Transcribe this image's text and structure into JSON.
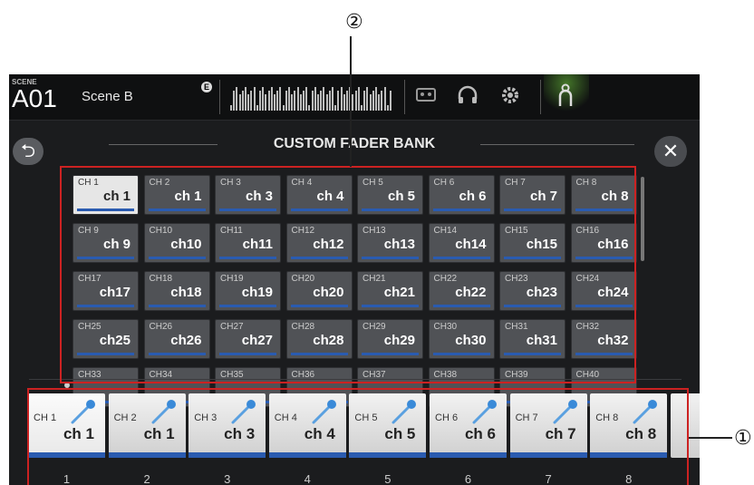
{
  "callouts": {
    "top": "②",
    "right": "①"
  },
  "topbar": {
    "scene_label": "SCENE",
    "scene_number": "A01",
    "scene_name": "Scene B",
    "edit_badge": "E"
  },
  "icons": {
    "recorder": "recorder-icon",
    "headphones": "headphones-icon",
    "settings": "gear-icon",
    "user": "user-icon",
    "back": "back-arrow-icon",
    "close": "close-icon",
    "mic": "microphone-icon"
  },
  "dialog": {
    "title": "CUSTOM FADER BANK",
    "back_symbol": "⮌",
    "close_symbol": "✕"
  },
  "accent_color": "#2a5bb0",
  "channel_grid": [
    {
      "num": "CH 1",
      "name": "ch 1",
      "selected": true
    },
    {
      "num": "CH 2",
      "name": "ch 1"
    },
    {
      "num": "CH 3",
      "name": "ch 3"
    },
    {
      "num": "CH 4",
      "name": "ch 4"
    },
    {
      "num": "CH 5",
      "name": "ch 5"
    },
    {
      "num": "CH 6",
      "name": "ch 6"
    },
    {
      "num": "CH 7",
      "name": "ch 7"
    },
    {
      "num": "CH 8",
      "name": "ch 8"
    },
    {
      "num": "CH 9",
      "name": "ch 9"
    },
    {
      "num": "CH10",
      "name": "ch10"
    },
    {
      "num": "CH11",
      "name": "ch11"
    },
    {
      "num": "CH12",
      "name": "ch12"
    },
    {
      "num": "CH13",
      "name": "ch13"
    },
    {
      "num": "CH14",
      "name": "ch14"
    },
    {
      "num": "CH15",
      "name": "ch15"
    },
    {
      "num": "CH16",
      "name": "ch16"
    },
    {
      "num": "CH17",
      "name": "ch17"
    },
    {
      "num": "CH18",
      "name": "ch18"
    },
    {
      "num": "CH19",
      "name": "ch19"
    },
    {
      "num": "CH20",
      "name": "ch20"
    },
    {
      "num": "CH21",
      "name": "ch21"
    },
    {
      "num": "CH22",
      "name": "ch22"
    },
    {
      "num": "CH23",
      "name": "ch23"
    },
    {
      "num": "CH24",
      "name": "ch24"
    },
    {
      "num": "CH25",
      "name": "ch25"
    },
    {
      "num": "CH26",
      "name": "ch26"
    },
    {
      "num": "CH27",
      "name": "ch27"
    },
    {
      "num": "CH28",
      "name": "ch28"
    },
    {
      "num": "CH29",
      "name": "ch29"
    },
    {
      "num": "CH30",
      "name": "ch30"
    },
    {
      "num": "CH31",
      "name": "ch31"
    },
    {
      "num": "CH32",
      "name": "ch32"
    },
    {
      "num": "CH33",
      "name": ""
    },
    {
      "num": "CH34",
      "name": ""
    },
    {
      "num": "CH35",
      "name": ""
    },
    {
      "num": "CH36",
      "name": ""
    },
    {
      "num": "CH37",
      "name": ""
    },
    {
      "num": "CH38",
      "name": ""
    },
    {
      "num": "CH39",
      "name": ""
    },
    {
      "num": "CH40",
      "name": ""
    }
  ],
  "fader_bank": [
    {
      "num": "CH 1",
      "name": "ch 1",
      "index": "1",
      "selected": true
    },
    {
      "num": "CH 2",
      "name": "ch 1",
      "index": "2"
    },
    {
      "num": "CH 3",
      "name": "ch 3",
      "index": "3"
    },
    {
      "num": "CH 4",
      "name": "ch 4",
      "index": "4"
    },
    {
      "num": "CH 5",
      "name": "ch 5",
      "index": "5"
    },
    {
      "num": "CH 6",
      "name": "ch 6",
      "index": "6"
    },
    {
      "num": "CH 7",
      "name": "ch 7",
      "index": "7"
    },
    {
      "num": "CH 8",
      "name": "ch 8",
      "index": "8"
    }
  ]
}
